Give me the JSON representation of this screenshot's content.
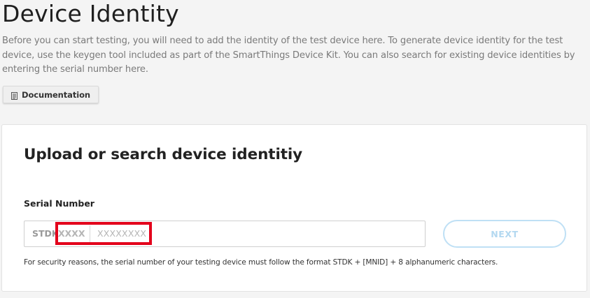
{
  "header": {
    "title": "Device Identity",
    "description": "Before you can start testing, you will need to add the identity of the test device here. To generate device identity for the test device, use the keygen tool included as part of the SmartThings Device Kit. You can also search for existing device identities by entering the serial number here.",
    "documentation_button": {
      "label": "Documentation",
      "icon": "document-icon"
    }
  },
  "card": {
    "title": "Upload or search device identitiy",
    "serial_field": {
      "label": "Serial Number",
      "prefix": "STDK",
      "mnid_placeholder": "XXXX",
      "serial_placeholder": "XXXXXXXX"
    },
    "next_button": {
      "label": "NEXT",
      "disabled": true
    },
    "helper_text": "For security reasons, the serial number of your testing device must follow the format STDK + [MNID] + 8 alphanumeric characters."
  },
  "colors": {
    "highlight": "#e3001b",
    "next_border": "#bfe0f5",
    "next_text": "#b3d8f0"
  }
}
